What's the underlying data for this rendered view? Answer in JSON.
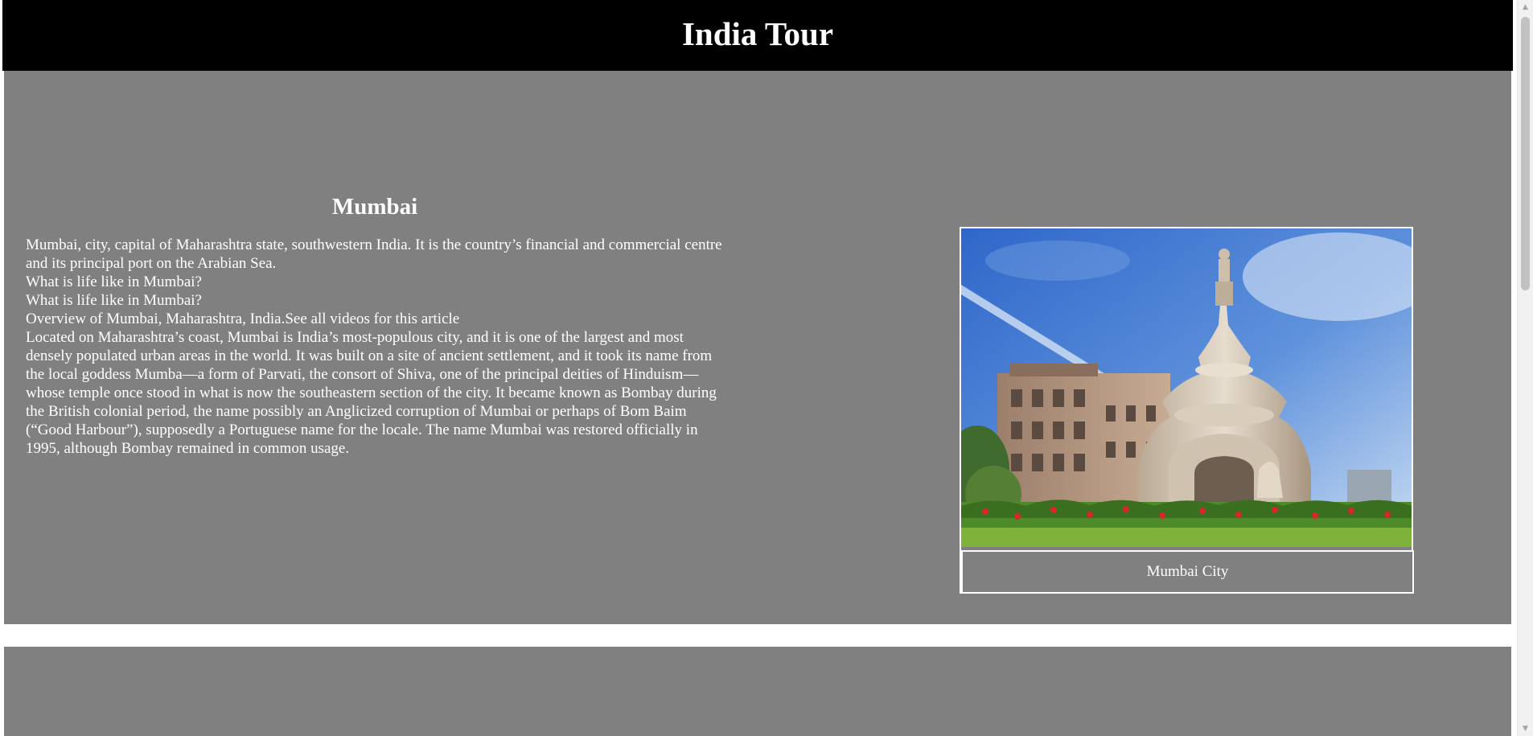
{
  "header": {
    "title": "India Tour"
  },
  "colors": {
    "header_background": "#000000",
    "section_background": "#808080",
    "border": "#ffffff",
    "text": "#ffffff"
  },
  "section": {
    "title": "Mumbai",
    "paragraphs": [
      "Mumbai, city, capital of Maharashtra state, southwestern India. It is the country’s financial and commercial centre and its principal port on the Arabian Sea.",
      "What is life like in Mumbai?",
      "What is life like in Mumbai?",
      "Overview of Mumbai, Maharashtra, India.See all videos for this article",
      "Located on Maharashtra’s coast, Mumbai is India’s most-populous city, and it is one of the largest and most densely populated urban areas in the world. It was built on a site of ancient settlement, and it took its name from the local goddess Mumba—a form of Parvati, the consort of Shiva, one of the principal deities of Hinduism—whose temple once stood in what is now the southeastern section of the city. It became known as Bombay during the British colonial period, the name possibly an Anglicized corruption of Mumbai or perhaps of Bom Baim (“Good Harbour”), supposedly a Portuguese name for the locale. The name Mumbai was restored officially in 1995, although Bombay remained in common usage."
    ],
    "image": {
      "subject": "Flora Fountain, Mumbai",
      "caption": "Mumbai City"
    }
  },
  "scrollbar": {
    "up_icon": "scroll-up-arrow-icon",
    "down_icon": "scroll-down-arrow-icon"
  }
}
